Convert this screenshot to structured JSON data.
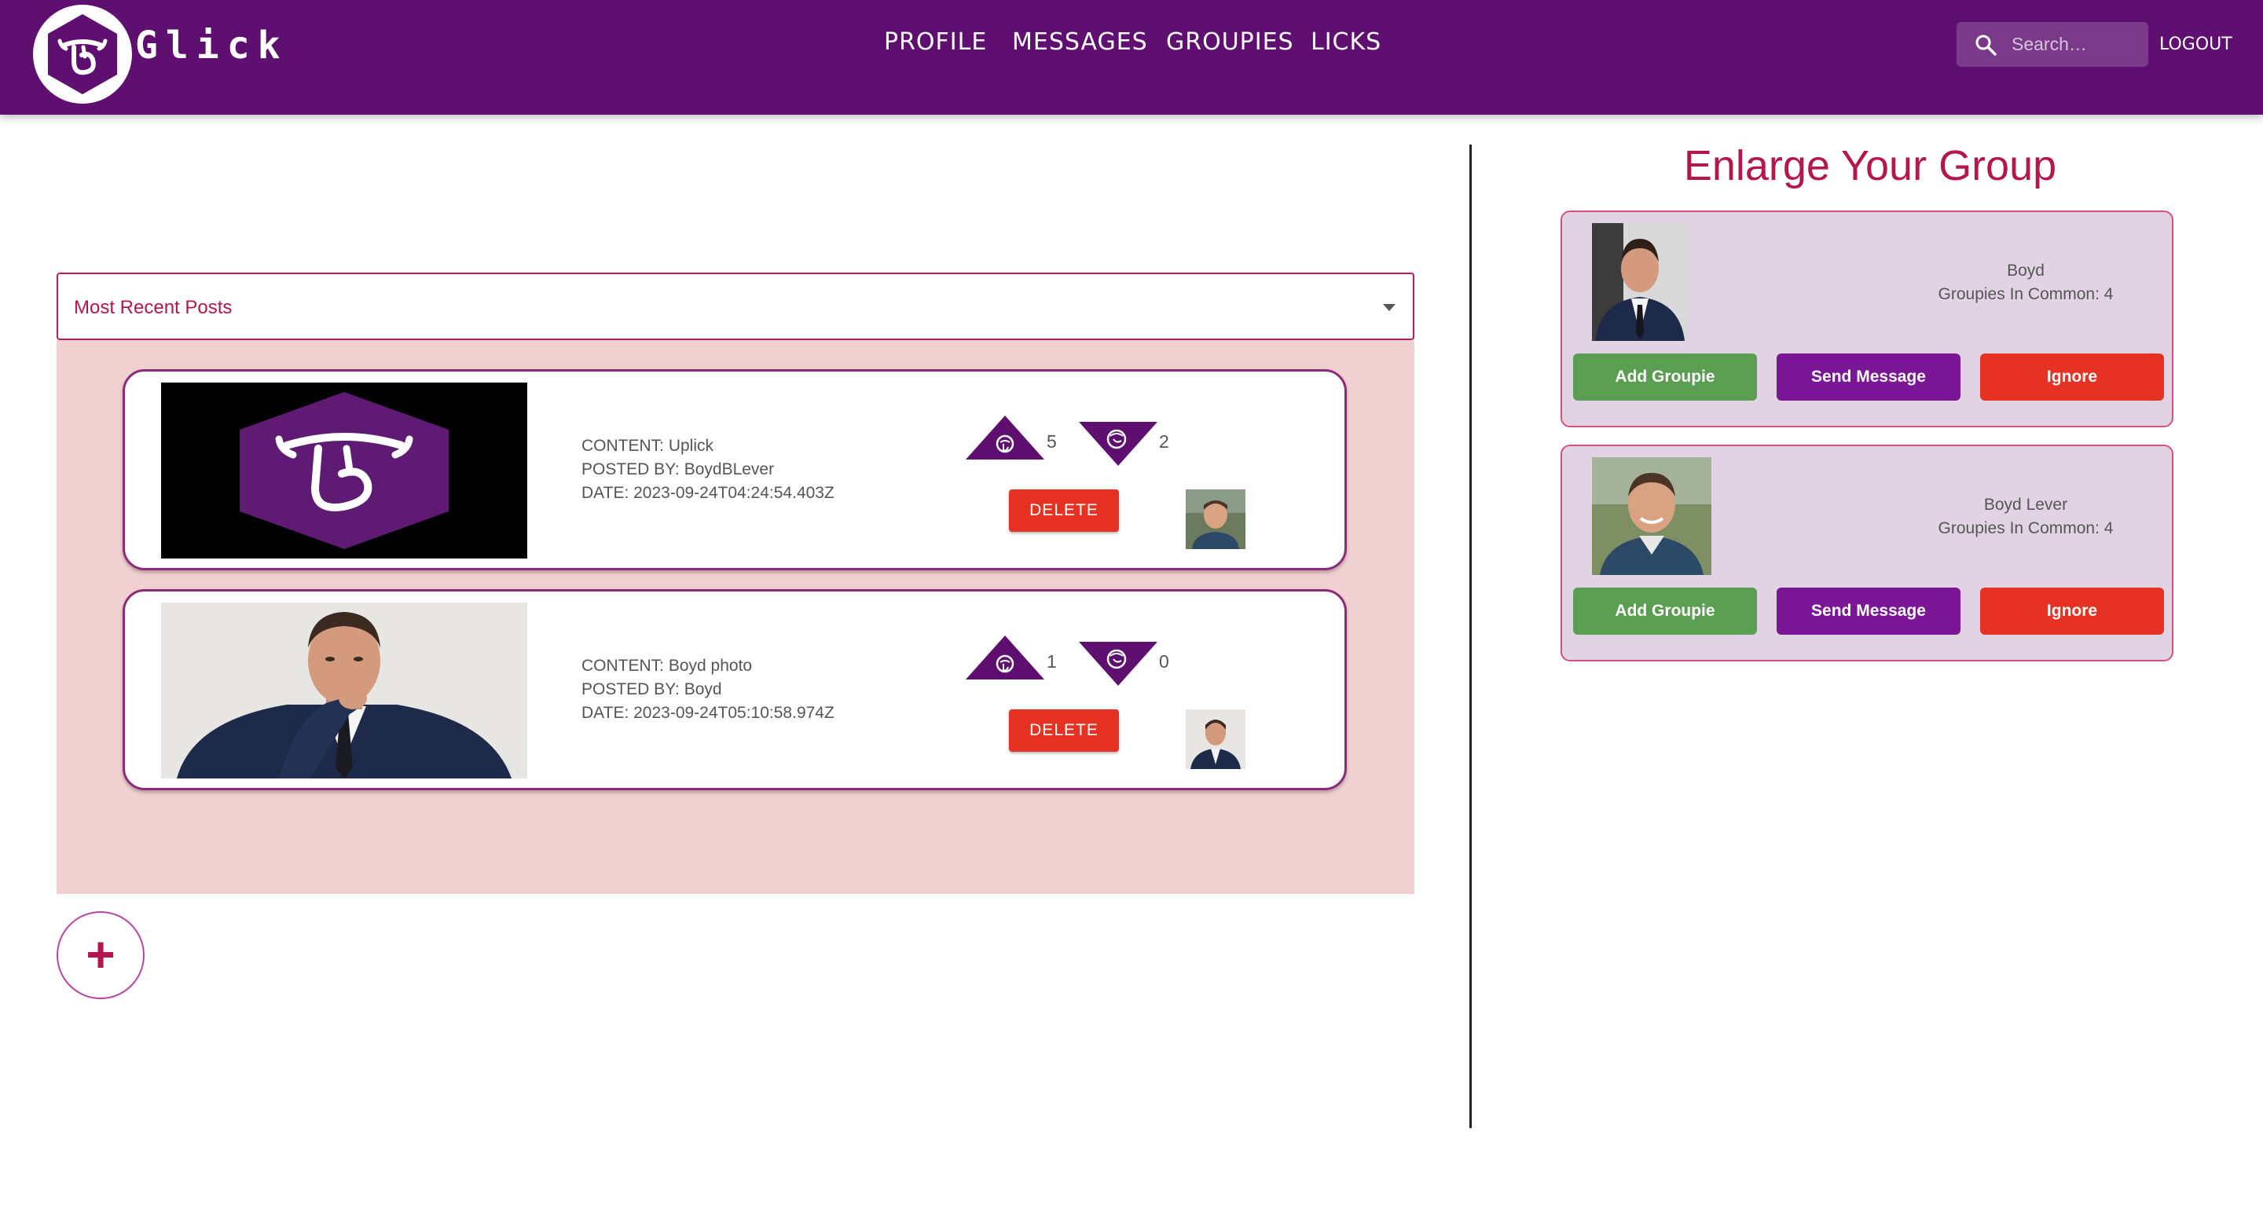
{
  "header": {
    "brand": "Glick",
    "nav": [
      "PROFILE",
      "MESSAGES",
      "GROUPIES",
      "LICKS"
    ],
    "search_placeholder": "Search…",
    "logout_label": "LOGOUT"
  },
  "posts": {
    "sort_label": "Most Recent Posts",
    "items": [
      {
        "content": "CONTENT: Uplick",
        "posted_by": "POSTED BY: BoydBLever",
        "date": "DATE: 2023-09-24T04:24:54.403Z",
        "up_count": "5",
        "down_count": "2",
        "delete_label": "DELETE"
      },
      {
        "content": "CONTENT: Boyd photo",
        "posted_by": "POSTED BY: Boyd",
        "date": "DATE: 2023-09-24T05:10:58.974Z",
        "up_count": "1",
        "down_count": "0",
        "delete_label": "DELETE"
      }
    ],
    "add_label": "+"
  },
  "suggestions": {
    "title": "Enlarge Your Group",
    "items": [
      {
        "name": "Boyd",
        "common": "Groupies In Common: 4",
        "add_label": "Add Groupie",
        "message_label": "Send Message",
        "ignore_label": "Ignore"
      },
      {
        "name": "Boyd Lever",
        "common": "Groupies In Common: 4",
        "add_label": "Add Groupie",
        "message_label": "Send Message",
        "ignore_label": "Ignore"
      }
    ]
  },
  "colors": {
    "header": "#5f0f6f",
    "accent": "#b3174d",
    "delete": "#e53222",
    "add": "#5a9e52",
    "message": "#7b1797"
  }
}
